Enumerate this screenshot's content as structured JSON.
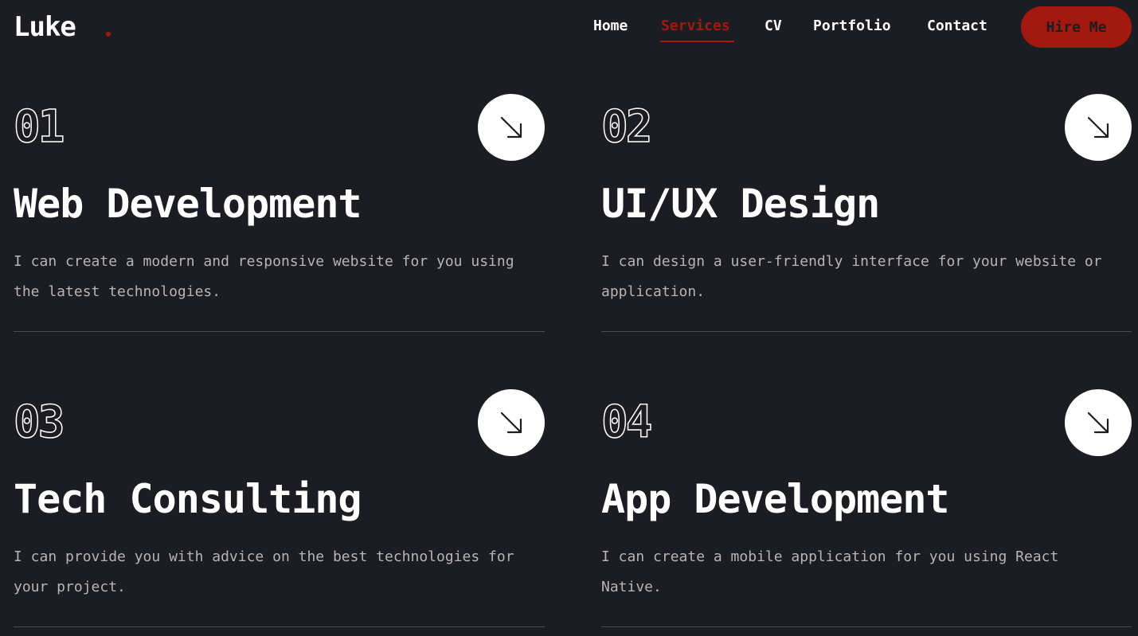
{
  "header": {
    "logo": "Luke",
    "nav": [
      {
        "label": "Home"
      },
      {
        "label": "Services"
      },
      {
        "label": "CV"
      },
      {
        "label": "Portfolio"
      },
      {
        "label": "Contact"
      }
    ],
    "active_nav": "Services",
    "hire_button": "Hire Me"
  },
  "colors": {
    "background": "#1b1d22",
    "accent": "#a3190f",
    "text": "#ffffff",
    "muted_text": "#b5b5b8"
  },
  "services": [
    {
      "number": "01",
      "title": "Web Development",
      "description": "I can create a modern and responsive website for you using the latest technologies.",
      "icon": "arrow-down-right-icon"
    },
    {
      "number": "02",
      "title": "UI/UX Design",
      "description": "I can design a user-friendly interface for your website or application.",
      "icon": "arrow-down-right-icon"
    },
    {
      "number": "03",
      "title": "Tech Consulting",
      "description": "I can provide you with advice on the best technologies for your project.",
      "icon": "arrow-down-right-icon"
    },
    {
      "number": "04",
      "title": "App Development",
      "description": "I can create a mobile application for you using React Native.",
      "icon": "arrow-down-right-icon"
    }
  ]
}
